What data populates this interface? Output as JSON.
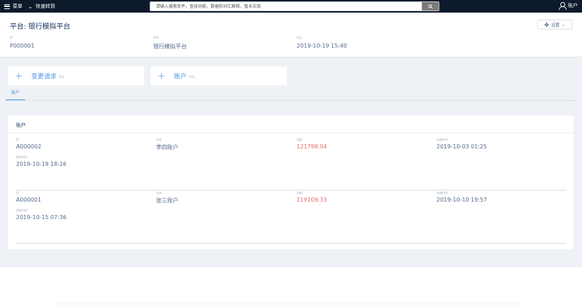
{
  "topbar": {
    "menu_label": "菜单",
    "quick_jump_label": "快速转到",
    "search_placeholder": "请输入搜索条件，查找功能、数据和词汇解释，暂未实现",
    "account_label": "账户"
  },
  "header": {
    "title": "平台: 银行模拟平台",
    "settings_label": "设置",
    "fields": [
      {
        "label": "ID",
        "value": "P000001"
      },
      {
        "label": "名称",
        "value": "银行模拟平台"
      },
      {
        "label": "创立",
        "value": "2019-10-19 15:40"
      }
    ]
  },
  "actions": [
    {
      "label": "变更请求",
      "sub": "添加"
    },
    {
      "label": "账户",
      "sub": "添加"
    }
  ],
  "tabs": [
    {
      "label": "账户"
    }
  ],
  "panel": {
    "title": "账户",
    "records": [
      {
        "id_label": "ID",
        "id": "A000002",
        "name_label": "名称",
        "name": "李四账户",
        "amount_label": "余额",
        "amount": "121798.04",
        "created_label": "创建时间",
        "created": "2019-10-03 01:25",
        "updated_label": "更新时间",
        "updated": "2019-10-19 18:26"
      },
      {
        "id_label": "ID",
        "id": "A000001",
        "name_label": "名称",
        "name": "张三账户",
        "amount_label": "余额",
        "amount": "119109.33",
        "created_label": "创建时间",
        "created": "2019-10-10 19:57",
        "updated_label": "更新时间",
        "updated": "2019-10-15 07:36"
      }
    ]
  },
  "colors": {
    "topbar": "#0d1a2b",
    "accent": "#4a90e2",
    "amount": "#ea6565",
    "background": "#eef1f5"
  }
}
